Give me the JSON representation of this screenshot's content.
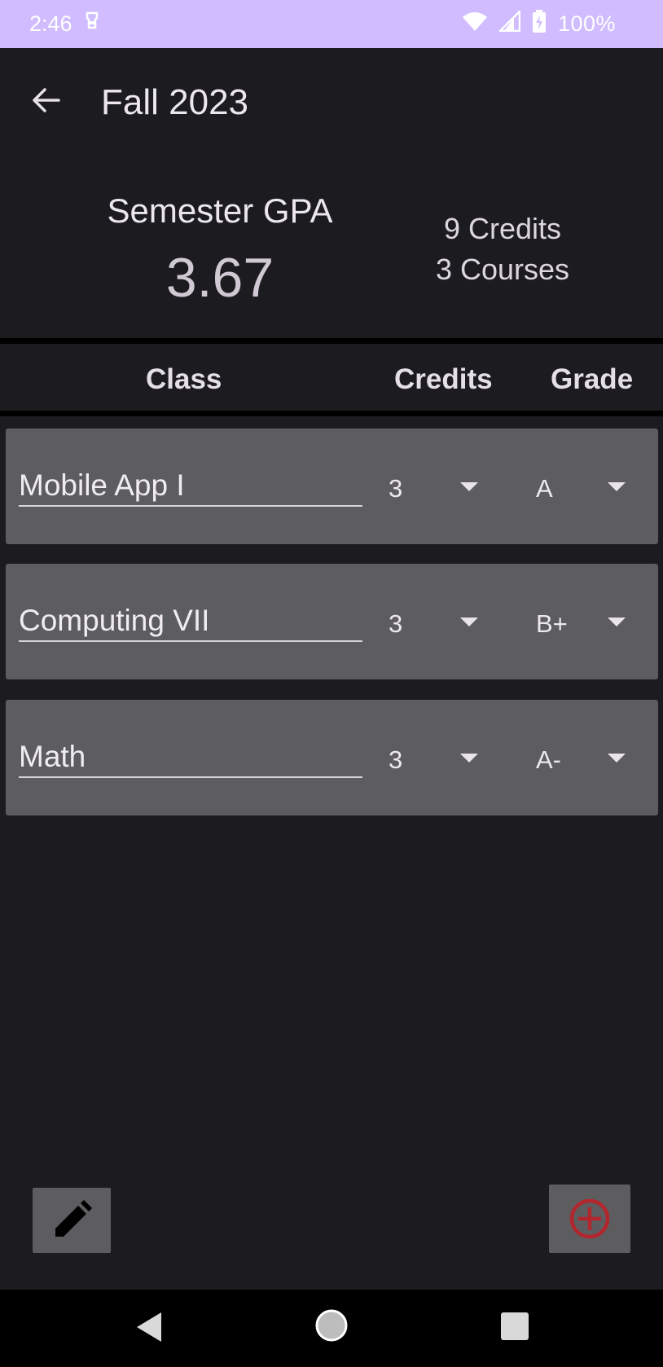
{
  "status_bar": {
    "time": "2:46",
    "battery": "100%"
  },
  "app_bar": {
    "title": "Fall 2023"
  },
  "summary": {
    "gpa_label": "Semester GPA",
    "gpa_value": "3.67",
    "credits": "9 Credits",
    "courses": "3 Courses"
  },
  "table_header": {
    "class": "Class",
    "credits": "Credits",
    "grade": "Grade"
  },
  "courses": [
    {
      "name": "Mobile App I",
      "credits": "3",
      "grade": "A"
    },
    {
      "name": "Computing VII",
      "credits": "3",
      "grade": "B+"
    },
    {
      "name": "Math",
      "credits": "3",
      "grade": "A-"
    }
  ],
  "colors": {
    "status_bar": "#d0bcff",
    "background": "#1c1b20",
    "row_background": "#5d5d60",
    "add_icon": "#b3262e"
  },
  "icons": {
    "back": "arrow-left-icon",
    "edit": "pencil-icon",
    "add": "plus-circle-icon"
  }
}
